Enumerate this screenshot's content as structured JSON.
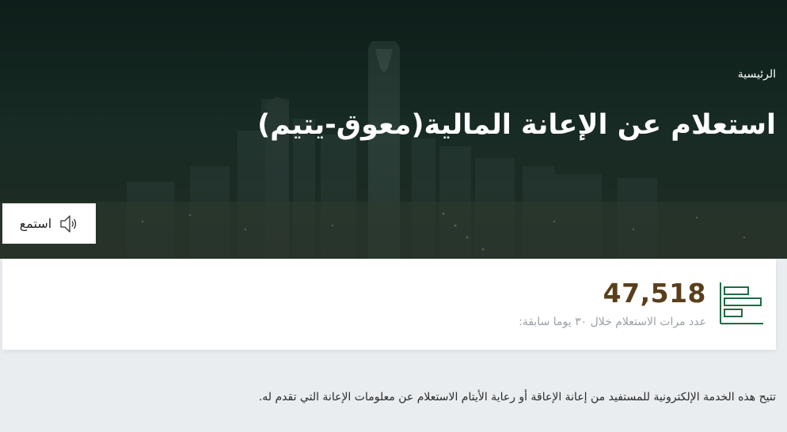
{
  "hero": {
    "breadcrumb": "الرئيسية",
    "title": "استعلام عن الإعانة المالية(معوق-يتيم)",
    "listen_label": "استمع"
  },
  "stats": {
    "count": "47,518",
    "caption": "عدد مرات الاستعلام خلال ٣٠ يوما سابقة:"
  },
  "description": "تتيح هذه الخدمة الإلكترونية للمستفيد من إعانة الإعاقة أو رعاية الأيتام الاستعلام عن معلومات الإعانة التي تقدم له.",
  "icons": {
    "speaker": "speaker-icon",
    "stats": "bar-chart-icon"
  },
  "colors": {
    "brand_green": "#1f6b45",
    "count_brown": "#5a3e1b"
  }
}
